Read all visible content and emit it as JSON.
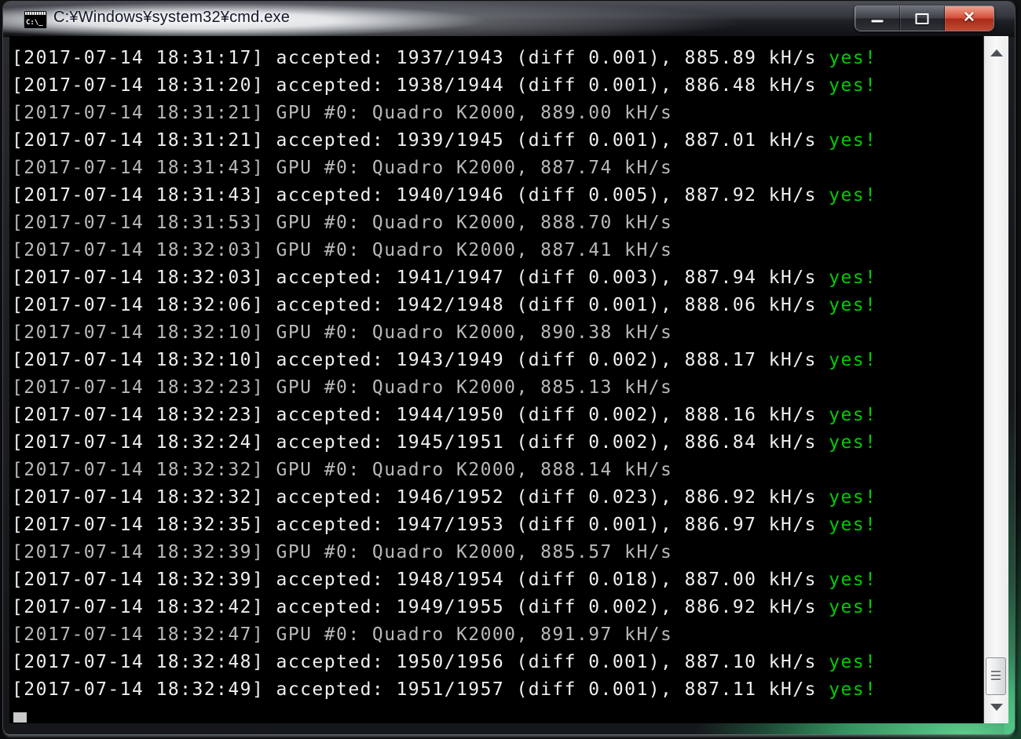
{
  "window": {
    "title": "C:¥Windows¥system32¥cmd.exe",
    "icon_text": "C:\\_",
    "controls": {
      "minimize_label": "minimize",
      "maximize_label": "maximize",
      "close_label": "close",
      "close_glyph": "✕"
    }
  },
  "terminal": {
    "cursor_visible": true,
    "scrollbar": {
      "orientation": "vertical",
      "thumb_position": "near-bottom"
    },
    "lines": [
      {
        "kind": "accepted",
        "text": "[2017-07-14 18:31:17] accepted: 1937/1943 (diff 0.001), 885.89 kH/s ",
        "result": "yes!"
      },
      {
        "kind": "accepted",
        "text": "[2017-07-14 18:31:20] accepted: 1938/1944 (diff 0.001), 886.48 kH/s ",
        "result": "yes!"
      },
      {
        "kind": "gpu",
        "text": "[2017-07-14 18:31:21] GPU #0: Quadro K2000, 889.00 kH/s",
        "result": ""
      },
      {
        "kind": "accepted",
        "text": "[2017-07-14 18:31:21] accepted: 1939/1945 (diff 0.001), 887.01 kH/s ",
        "result": "yes!"
      },
      {
        "kind": "gpu",
        "text": "[2017-07-14 18:31:43] GPU #0: Quadro K2000, 887.74 kH/s",
        "result": ""
      },
      {
        "kind": "accepted",
        "text": "[2017-07-14 18:31:43] accepted: 1940/1946 (diff 0.005), 887.92 kH/s ",
        "result": "yes!"
      },
      {
        "kind": "gpu",
        "text": "[2017-07-14 18:31:53] GPU #0: Quadro K2000, 888.70 kH/s",
        "result": ""
      },
      {
        "kind": "gpu",
        "text": "[2017-07-14 18:32:03] GPU #0: Quadro K2000, 887.41 kH/s",
        "result": ""
      },
      {
        "kind": "accepted",
        "text": "[2017-07-14 18:32:03] accepted: 1941/1947 (diff 0.003), 887.94 kH/s ",
        "result": "yes!"
      },
      {
        "kind": "accepted",
        "text": "[2017-07-14 18:32:06] accepted: 1942/1948 (diff 0.001), 888.06 kH/s ",
        "result": "yes!"
      },
      {
        "kind": "gpu",
        "text": "[2017-07-14 18:32:10] GPU #0: Quadro K2000, 890.38 kH/s",
        "result": ""
      },
      {
        "kind": "accepted",
        "text": "[2017-07-14 18:32:10] accepted: 1943/1949 (diff 0.002), 888.17 kH/s ",
        "result": "yes!"
      },
      {
        "kind": "gpu",
        "text": "[2017-07-14 18:32:23] GPU #0: Quadro K2000, 885.13 kH/s",
        "result": ""
      },
      {
        "kind": "accepted",
        "text": "[2017-07-14 18:32:23] accepted: 1944/1950 (diff 0.002), 888.16 kH/s ",
        "result": "yes!"
      },
      {
        "kind": "accepted",
        "text": "[2017-07-14 18:32:24] accepted: 1945/1951 (diff 0.002), 886.84 kH/s ",
        "result": "yes!"
      },
      {
        "kind": "gpu",
        "text": "[2017-07-14 18:32:32] GPU #0: Quadro K2000, 888.14 kH/s",
        "result": ""
      },
      {
        "kind": "accepted",
        "text": "[2017-07-14 18:32:32] accepted: 1946/1952 (diff 0.023), 886.92 kH/s ",
        "result": "yes!"
      },
      {
        "kind": "accepted",
        "text": "[2017-07-14 18:32:35] accepted: 1947/1953 (diff 0.001), 886.97 kH/s ",
        "result": "yes!"
      },
      {
        "kind": "gpu",
        "text": "[2017-07-14 18:32:39] GPU #0: Quadro K2000, 885.57 kH/s",
        "result": ""
      },
      {
        "kind": "accepted",
        "text": "[2017-07-14 18:32:39] accepted: 1948/1954 (diff 0.018), 887.00 kH/s ",
        "result": "yes!"
      },
      {
        "kind": "accepted",
        "text": "[2017-07-14 18:32:42] accepted: 1949/1955 (diff 0.002), 886.92 kH/s ",
        "result": "yes!"
      },
      {
        "kind": "gpu",
        "text": "[2017-07-14 18:32:47] GPU #0: Quadro K2000, 891.97 kH/s",
        "result": ""
      },
      {
        "kind": "accepted",
        "text": "[2017-07-14 18:32:48] accepted: 1950/1956 (diff 0.001), 887.10 kH/s ",
        "result": "yes!"
      },
      {
        "kind": "accepted",
        "text": "[2017-07-14 18:32:49] accepted: 1951/1957 (diff 0.001), 887.11 kH/s ",
        "result": "yes!"
      }
    ]
  },
  "colors": {
    "console_background": "#000000",
    "accepted_text": "#efefef",
    "gpu_text": "#b9b9b9",
    "success_green": "#00cc00",
    "close_button_red": "#c14b32"
  }
}
